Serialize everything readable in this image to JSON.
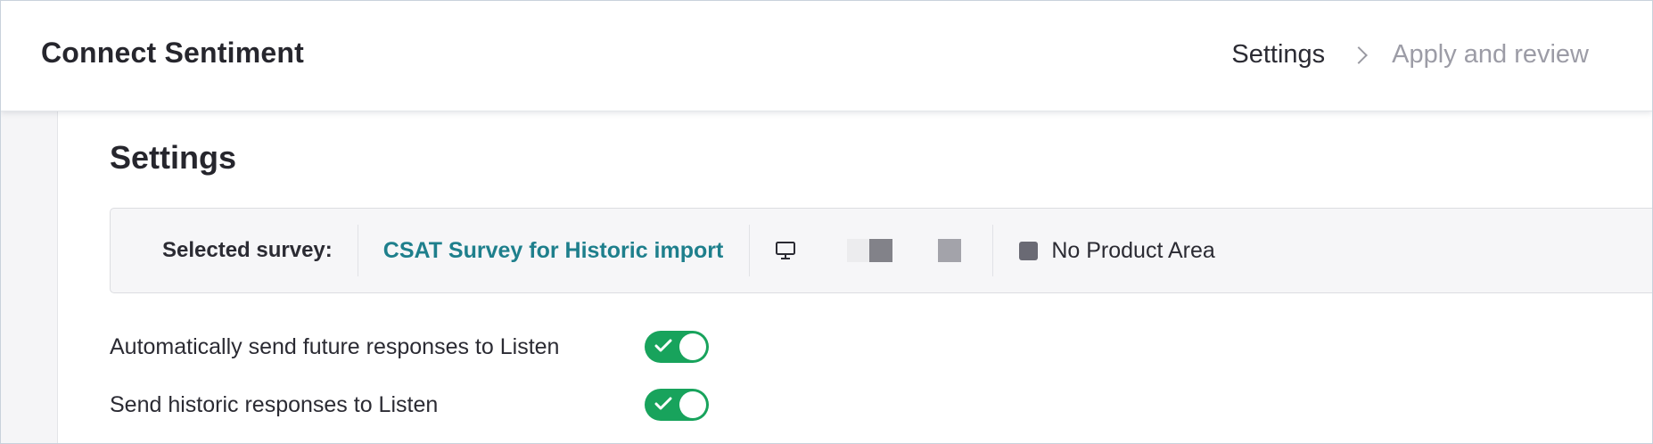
{
  "header": {
    "title": "Connect Sentiment",
    "breadcrumb": [
      {
        "label": "Settings",
        "state": "current"
      },
      {
        "label": "Apply and review",
        "state": "upcoming"
      }
    ]
  },
  "main": {
    "section_title": "Settings",
    "survey_bar": {
      "label": "Selected survey:",
      "survey_name": "CSAT Survey for Historic import",
      "channel_icon": "monitor-icon",
      "product_area": "No Product Area"
    },
    "toggles": [
      {
        "label": "Automatically send future responses to Listen",
        "enabled": true
      },
      {
        "label": "Send historic responses to Listen",
        "enabled": true
      }
    ]
  },
  "colors": {
    "link": "#1e7f8c",
    "toggle_on": "#18a35c",
    "text": "#26262d",
    "muted": "#9c9ca6"
  }
}
